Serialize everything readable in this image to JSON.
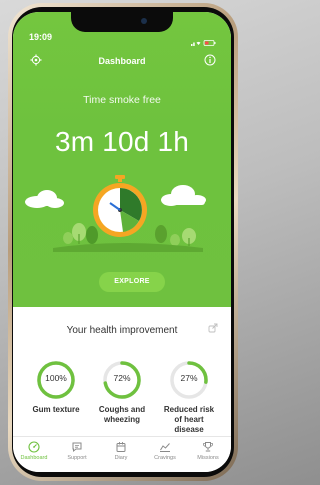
{
  "status_bar": {
    "time": "19:09"
  },
  "header": {
    "title": "Dashboard"
  },
  "smoke_free": {
    "label": "Time smoke free",
    "value": "3m 10d 1h"
  },
  "explore_button": {
    "label": "EXPLORE"
  },
  "health": {
    "title": "Your health improvement",
    "items": [
      {
        "percent": "100%",
        "progress": 1.0,
        "label": "Gum texture"
      },
      {
        "percent": "72%",
        "progress": 0.72,
        "label": "Coughs and wheezing"
      },
      {
        "percent": "27%",
        "progress": 0.27,
        "label": "Reduced risk of heart disease"
      }
    ]
  },
  "tabs": [
    {
      "label": "Dashboard",
      "icon": "gauge-icon",
      "active": true
    },
    {
      "label": "Support",
      "icon": "chat-icon",
      "active": false
    },
    {
      "label": "Diary",
      "icon": "calendar-icon",
      "active": false
    },
    {
      "label": "Cravings",
      "icon": "chart-icon",
      "active": false
    },
    {
      "label": "Missions",
      "icon": "trophy-icon",
      "active": false
    }
  ],
  "colors": {
    "accent": "#6fc13f",
    "clock_ring": "#f5a623",
    "track": "#e6e6e6"
  }
}
